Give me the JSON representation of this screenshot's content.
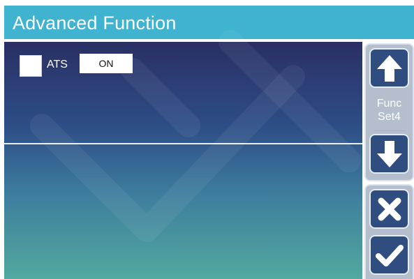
{
  "header": {
    "title": "Advanced Function"
  },
  "ats": {
    "label": "ATS",
    "value": "ON",
    "checked": false
  },
  "sidebar": {
    "func_label_line1": "Func",
    "func_label_line2": "Set4",
    "buttons": [
      {
        "name": "up",
        "icon": "arrow-up-icon"
      },
      {
        "name": "down",
        "icon": "arrow-down-icon"
      },
      {
        "name": "close",
        "icon": "close-x-icon"
      },
      {
        "name": "confirm",
        "icon": "checkmark-icon"
      }
    ]
  },
  "colors": {
    "header_bg": "#3fb3d0",
    "panel_top": "#2a2f64",
    "panel_bottom": "#52a99f",
    "button_bg": "#2f4d7e",
    "text": "#ffffff"
  }
}
